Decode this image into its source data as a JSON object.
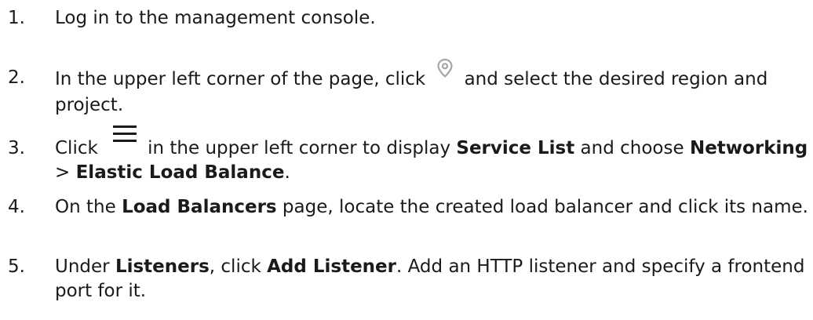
{
  "steps": [
    {
      "number": "1.",
      "text": "Log in to the management console."
    },
    {
      "number": "2.",
      "before_icon": "In the upper left corner of the page, click",
      "icon": "location-pin-icon",
      "after_icon": "and select the desired region and project."
    },
    {
      "number": "3.",
      "click": "Click",
      "icon": "hamburger-menu-icon",
      "mid1": "in the upper left corner to display",
      "service_list": "Service List",
      "mid2": "and choose",
      "networking": "Networking",
      "sep": ">",
      "elb": "Elastic Load Balance",
      "end": "."
    },
    {
      "number": "4.",
      "pre": "On the",
      "bold": "Load Balancers",
      "post": "page, locate the created load balancer and click its name."
    },
    {
      "number": "5.",
      "pre": "Under",
      "listeners": "Listeners",
      "mid": ", click",
      "add_listener": "Add Listener",
      "post": ". Add an HTTP listener and specify a frontend port for it."
    }
  ],
  "icon_colors": {
    "pin": "#a5a5a5",
    "menu": "#1a1a1a"
  }
}
